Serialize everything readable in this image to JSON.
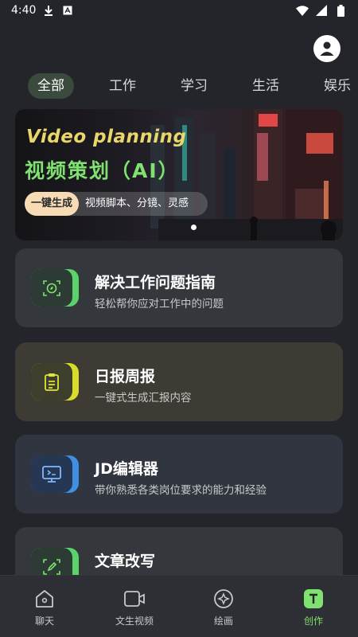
{
  "status_bar": {
    "time": "4:40",
    "icons": [
      "download-icon",
      "text-icon",
      "wifi-icon",
      "signal-icon",
      "battery-icon"
    ]
  },
  "header": {
    "avatar": "user-avatar-icon"
  },
  "tabs": [
    {
      "label": "全部",
      "active": true
    },
    {
      "label": "工作",
      "active": false
    },
    {
      "label": "学习",
      "active": false
    },
    {
      "label": "生活",
      "active": false
    },
    {
      "label": "娱乐",
      "active": false
    }
  ],
  "banner": {
    "title_en": "Video planning",
    "title_cn": "视频策划（AI）",
    "button": "一键生成",
    "tagline": "视频脚本、分镜、灵感"
  },
  "cards": [
    {
      "title": "解决工作问题指南",
      "subtitle": "轻松帮你应对工作中的问题",
      "icon": "compass-icon",
      "accent": "#5ad36a"
    },
    {
      "title": "日报周报",
      "subtitle": "一键式生成汇报内容",
      "icon": "clipboard-icon",
      "accent": "#d8dc2a"
    },
    {
      "title": "JD编辑器",
      "subtitle": "带你熟悉各类岗位要求的能力和经验",
      "icon": "monitor-icon",
      "accent": "#3f8fe3"
    },
    {
      "title": "文章改写",
      "subtitle": "",
      "icon": "edit-icon",
      "accent": "#5ad36a"
    }
  ],
  "bottom_nav": [
    {
      "label": "聊天",
      "icon": "home-chat-icon",
      "active": false
    },
    {
      "label": "文生视频",
      "icon": "video-camera-icon",
      "active": false
    },
    {
      "label": "绘画",
      "icon": "paint-icon",
      "active": false
    },
    {
      "label": "创作",
      "icon": "text-create-icon",
      "active": true
    }
  ],
  "colors": {
    "background": "#23252a",
    "accent_green": "#7fe16f",
    "banner_en": "#e9d76a"
  }
}
